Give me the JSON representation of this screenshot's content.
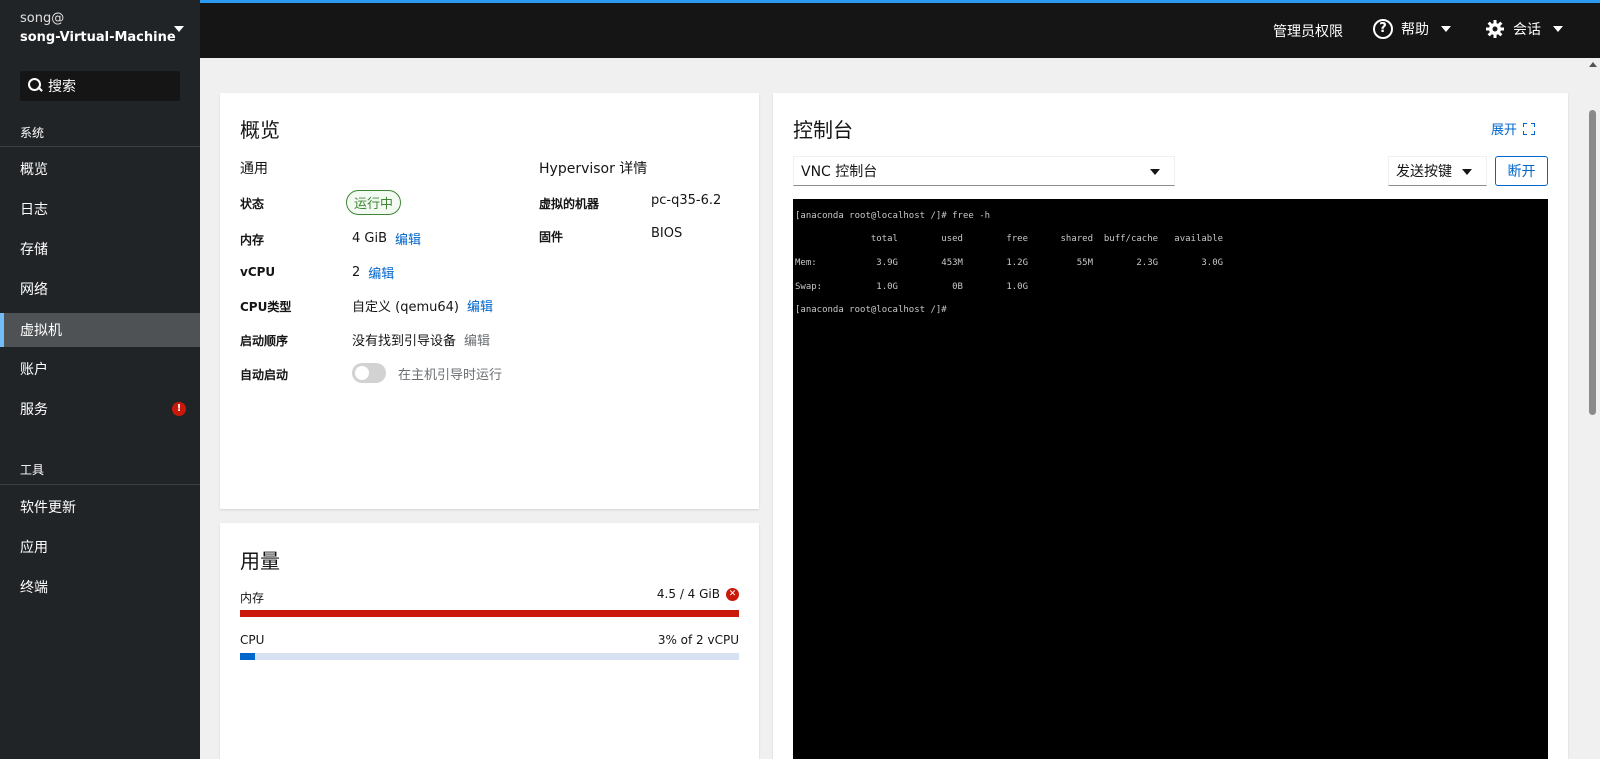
{
  "sidebar": {
    "host_user": "song@",
    "host_name": "song-Virtual-Machine",
    "search_placeholder": "搜索",
    "section_system": "系统",
    "section_tools": "工具",
    "items": [
      {
        "label": "概览",
        "active": false
      },
      {
        "label": "日志",
        "active": false
      },
      {
        "label": "存储",
        "active": false
      },
      {
        "label": "网络",
        "active": false
      },
      {
        "label": "虚拟机",
        "active": true
      },
      {
        "label": "账户",
        "active": false
      },
      {
        "label": "服务",
        "active": false,
        "badge": "!"
      }
    ],
    "tool_items": [
      {
        "label": "软件更新"
      },
      {
        "label": "应用"
      },
      {
        "label": "终端"
      }
    ]
  },
  "topbar": {
    "admin": "管理员权限",
    "help": "帮助",
    "session": "会话"
  },
  "overview": {
    "title": "概览",
    "general_title": "通用",
    "hypervisor_title": "Hypervisor 详情",
    "status_label": "状态",
    "status_value": "运行中",
    "memory_label": "内存",
    "memory_value": "4 GiB",
    "vcpu_label": "vCPU",
    "vcpu_value": "2",
    "cputype_label": "CPU类型",
    "cputype_value": "自定义 (qemu64)",
    "boot_label": "启动顺序",
    "boot_value": "没有找到引导设备",
    "autostart_label": "自动启动",
    "autostart_value": "在主机引导时运行",
    "autostart_on": false,
    "edit": "编辑",
    "machine_label": "虚拟的机器",
    "machine_value": "pc-q35-6.2",
    "firmware_label": "固件",
    "firmware_value": "BIOS"
  },
  "usage": {
    "title": "用量",
    "memory_label": "内存",
    "memory_value": "4.5 / 4 GiB",
    "memory_fraction": 1.0,
    "memory_color": "#c9190b",
    "cpu_label": "CPU",
    "cpu_value": "3% of 2 vCPU",
    "cpu_fraction": 0.03,
    "cpu_color": "#0066cc"
  },
  "console": {
    "title": "控制台",
    "expand": "展开",
    "type_select": "VNC 控制台",
    "send_key": "发送按键",
    "disconnect": "断开",
    "terminal_lines": [
      "[anaconda root@localhost /]# free -h",
      "              total        used        free      shared  buff/cache   available",
      "Mem:           3.9G        453M        1.2G         55M        2.3G        3.0G",
      "Swap:          1.0G          0B        1.0G",
      "[anaconda root@localhost /]#"
    ]
  }
}
